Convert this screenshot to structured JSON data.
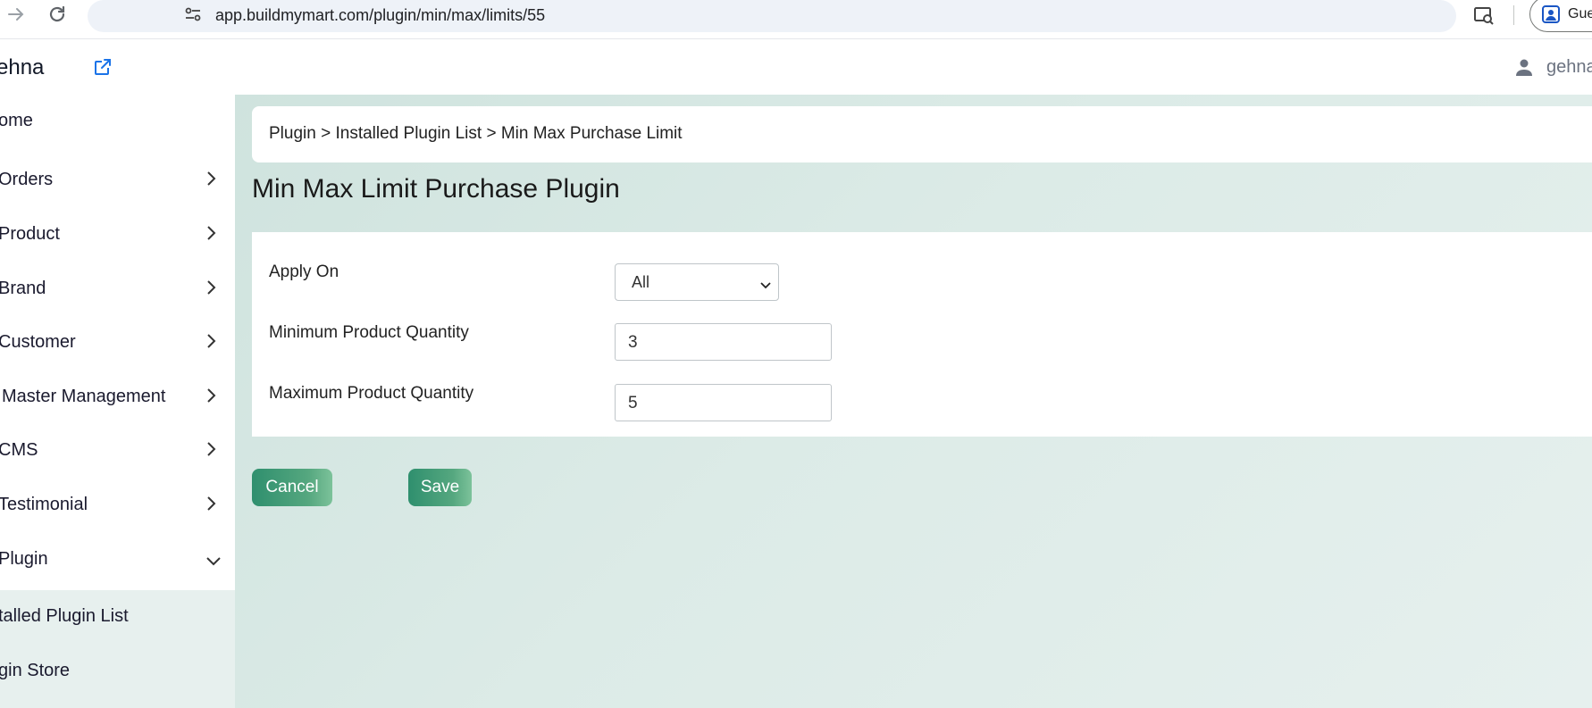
{
  "browser": {
    "url": "app.buildmymart.com/plugin/min/max/limits/55",
    "profile_label": "Guest"
  },
  "header": {
    "store_name": "ehna",
    "user_name": "gehna"
  },
  "sidebar": {
    "items": [
      {
        "label": "ome",
        "has_chevron": false
      },
      {
        "label": "Orders",
        "has_chevron": true
      },
      {
        "label": "Product",
        "has_chevron": true
      },
      {
        "label": "Brand",
        "has_chevron": true
      },
      {
        "label": "Customer",
        "has_chevron": true
      },
      {
        "label": "Master Management",
        "has_chevron": true
      },
      {
        "label": "CMS",
        "has_chevron": true
      },
      {
        "label": "Testimonial",
        "has_chevron": true
      },
      {
        "label": "Plugin",
        "expanded": true
      }
    ],
    "submenu": [
      {
        "label": "talled Plugin List"
      },
      {
        "label": "gin Store"
      }
    ]
  },
  "main": {
    "breadcrumb": "Plugin > Installed Plugin List > Min Max Purchase Limit",
    "title": "Min Max Limit Purchase Plugin",
    "form": {
      "apply_on_label": "Apply On",
      "apply_on_value": "All",
      "min_label": "Minimum Product Quantity",
      "min_value": "3",
      "max_label": "Maximum Product Quantity",
      "max_value": "5"
    },
    "buttons": {
      "cancel": "Cancel",
      "save": "Save"
    }
  },
  "colors": {
    "accent": "#3a9775",
    "main_bg": "#d4e6e1",
    "link_icon": "#1a73e8"
  }
}
